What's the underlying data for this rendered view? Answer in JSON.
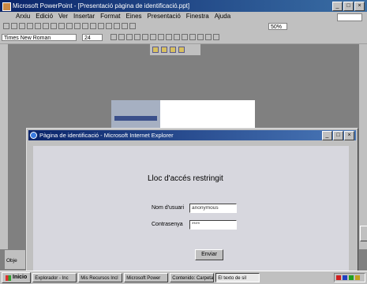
{
  "app_window": {
    "title": "Microsoft PowerPoint - [Presentació pàgina de identificació.ppt]",
    "buttons": [
      "_",
      "□",
      "×"
    ]
  },
  "menu": {
    "items": [
      "Arxiu",
      "Edició",
      "Ver",
      "Insertar",
      "Format",
      "Eines",
      "Presentació",
      "Finestra",
      "Ajuda"
    ]
  },
  "toolbar": {
    "font": "Times New Roman",
    "size": "24",
    "zoom": "50%"
  },
  "login_dialog": {
    "title": "Pàgina de identificació - Microsoft Internet Explorer",
    "heading": "Lloc d'accés restringit",
    "user_label": "Nom d'usuari",
    "user_value": "anonymous",
    "password_label": "Contrasenya",
    "password_value": "****",
    "submit_label": "Enviar"
  },
  "side_panel": {
    "tab_label": "Obje"
  },
  "taskbar": {
    "start_label": "Inicio",
    "tasks": [
      {
        "label": "Explorador - Inc",
        "active": false
      },
      {
        "label": "Mis Recursos Incl",
        "active": false
      },
      {
        "label": "Microsoft Power",
        "active": false
      },
      {
        "label": "Contenido: Carpeta",
        "active": false
      },
      {
        "label": "El texto de sil",
        "active": true
      }
    ]
  }
}
